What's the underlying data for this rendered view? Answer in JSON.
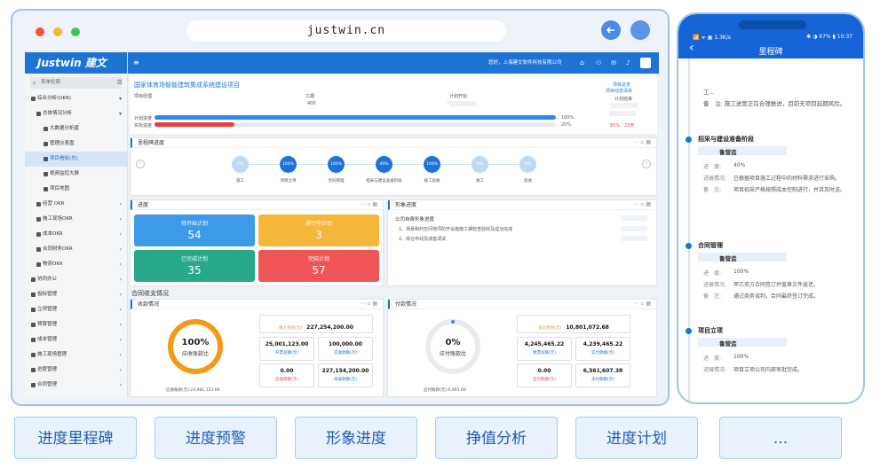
{
  "browser": {
    "url": "justwin.cn"
  },
  "app": {
    "logo": "Justwin 建文",
    "search_placeholder": "菜单检索",
    "topbar_menu_icon": "≡",
    "topbar_user": "您好，上海建文软件科技有限公司",
    "sidebar": [
      {
        "label": "综合分析(OKR)",
        "level": 0,
        "arrow": "▾"
      },
      {
        "label": "总体情况分析",
        "level": 1,
        "arrow": "▾"
      },
      {
        "label": "大数据分析盘",
        "level": 2,
        "arrow": ""
      },
      {
        "label": "管理仪表盘",
        "level": 2,
        "arrow": ""
      },
      {
        "label": "项目看板(总)",
        "level": 2,
        "arrow": "",
        "active": true
      },
      {
        "label": "视频监控大屏",
        "level": 2,
        "arrow": ""
      },
      {
        "label": "项目地图",
        "level": 2,
        "arrow": ""
      },
      {
        "label": "经营 OKR",
        "level": 1,
        "arrow": "›"
      },
      {
        "label": "施工现场OKR",
        "level": 1,
        "arrow": "›"
      },
      {
        "label": "成本OKR",
        "level": 1,
        "arrow": "›"
      },
      {
        "label": "合同财务OKR",
        "level": 1,
        "arrow": "›"
      },
      {
        "label": "物资OKR",
        "level": 1,
        "arrow": "›"
      },
      {
        "label": "协同办公",
        "level": 0,
        "arrow": "›"
      },
      {
        "label": "投标管理",
        "level": 0,
        "arrow": "›"
      },
      {
        "label": "立项管理",
        "level": 0,
        "arrow": "›"
      },
      {
        "label": "预算管理",
        "level": 0,
        "arrow": "›"
      },
      {
        "label": "成本管理",
        "level": 0,
        "arrow": "›"
      },
      {
        "label": "施工现场管理",
        "level": 0,
        "arrow": "›"
      },
      {
        "label": "进度管理",
        "level": 0,
        "arrow": "›"
      },
      {
        "label": "合同管理",
        "level": 0,
        "arrow": "›"
      }
    ],
    "project": {
      "title": "国家体育场智能建筑集成系统建设项目",
      "col1": "项目经理",
      "col2": "工期",
      "col2_val": "400",
      "col3": "计划开始",
      "col3_val": ":",
      "col4": "计划结束",
      "link1": "项目总览",
      "link2": "项目动态清单",
      "plan_label": "计划进度",
      "plan_pct": "100%",
      "actual_label": "实际进度",
      "actual_pct": "20%",
      "plan_fraction": 1.0,
      "actual_fraction": 0.2,
      "warn": "85% : 23天"
    },
    "milestone_panel": {
      "title": "里程碑进度",
      "nodes": [
        {
          "pct": "0%",
          "label": "施工",
          "done": false
        },
        {
          "pct": "100%",
          "label": "项目立项",
          "done": true
        },
        {
          "pct": "100%",
          "label": "合同管理",
          "done": true
        },
        {
          "pct": "40%",
          "label": "招采与建设准备阶段",
          "done": true
        },
        {
          "pct": "100%",
          "label": "竣工验收",
          "done": true
        },
        {
          "pct": "0%",
          "label": "竣工",
          "done": false
        },
        {
          "pct": "0%",
          "label": "验收",
          "done": false
        }
      ]
    },
    "progress_panel": {
      "title": "进度",
      "boxes": [
        {
          "label": "待开始计划",
          "value": "54",
          "color": "#3c9be8"
        },
        {
          "label": "进行中计划",
          "value": "3",
          "color": "#f4b73a"
        },
        {
          "label": "已完成计划",
          "value": "35",
          "color": "#27a88a"
        },
        {
          "label": "完结计划",
          "value": "57",
          "color": "#ee5656"
        }
      ]
    },
    "image_panel": {
      "title": "形象进度",
      "heading": "公司自费形象进度",
      "items": [
        "1、场景和约空间地坪防开设施施工期检查验收及成功完成",
        "2、综合布线及成套调试"
      ]
    },
    "contract_heading": "合同收支情况",
    "income": {
      "title": "收款情况",
      "pct": "100%",
      "sub": "应收账款比",
      "footer": "应收账款(元):24,981,123.00",
      "top_label": "收入合同(元)",
      "top_value": "227,254,200.00",
      "stats": [
        {
          "value": "25,001,123.00",
          "label": "开票总额(元)",
          "color": "#1e74d4"
        },
        {
          "value": "100,000.00",
          "label": "实收款额(元)",
          "color": "#1e74d4"
        },
        {
          "value": "0.00",
          "label": "应收款额(元)",
          "color": "#e24c4c"
        },
        {
          "value": "227,154,200.00",
          "label": "未收款额(元)",
          "color": "#1e74d4"
        }
      ]
    },
    "payment": {
      "title": "付款情况",
      "pct": "0%",
      "sub": "应付账款比",
      "footer": "应付账款(元):6,693.00",
      "top_label": "支出合同(元)",
      "top_value": "10,801,072.68",
      "stats": [
        {
          "value": "4,245,465.22",
          "label": "收票总额(元)",
          "color": "#1e74d4"
        },
        {
          "value": "4,239,465.22",
          "label": "实付款额(元)",
          "color": "#1e74d4"
        },
        {
          "value": "0.00",
          "label": "应付款额(元)",
          "color": "#e24c4c"
        },
        {
          "value": "6,561,607.38",
          "label": "未付款额(元)",
          "color": "#1e74d4"
        }
      ]
    }
  },
  "phone": {
    "status_left": "📶 ᯤ ▣ 1.3K/s",
    "status_right": "✱ ◑ 97% ▮ 10:37",
    "title": "里程碑",
    "back_icon": "‹",
    "top_line1": "工...",
    "top_line2_label": "备　注:",
    "top_line2": "施工进度正在合理推进，目前无项目延期风险。",
    "sections": [
      {
        "title": "招采与建设准备阶段",
        "person": "鲁营造",
        "progress_label": "进　度:",
        "progress": "40%",
        "status_label": "进展情况:",
        "status": "已根据项目施工过程中的材料需求进行采购。",
        "note_label": "备　注:",
        "note": "项目招采严格按照成本控制进行，并且及时送。"
      },
      {
        "title": "合同管理",
        "person": "鲁营造",
        "progress_label": "进　度:",
        "progress": "100%",
        "status_label": "进展情况:",
        "status": "甲乙双方合同签订并盖章文件返还。",
        "note_label": "备　注:",
        "note": "通过商务谈判，合同最终签订完成。"
      },
      {
        "title": "项目立项",
        "person": "鲁营造",
        "progress_label": "进　度:",
        "progress": "100%",
        "status_label": "进展情况:",
        "status": "项目立项公司内部审批完成。"
      }
    ]
  },
  "features": [
    "进度里程碑",
    "进度预警",
    "形象进度",
    "挣值分析",
    "进度计划",
    "..."
  ]
}
